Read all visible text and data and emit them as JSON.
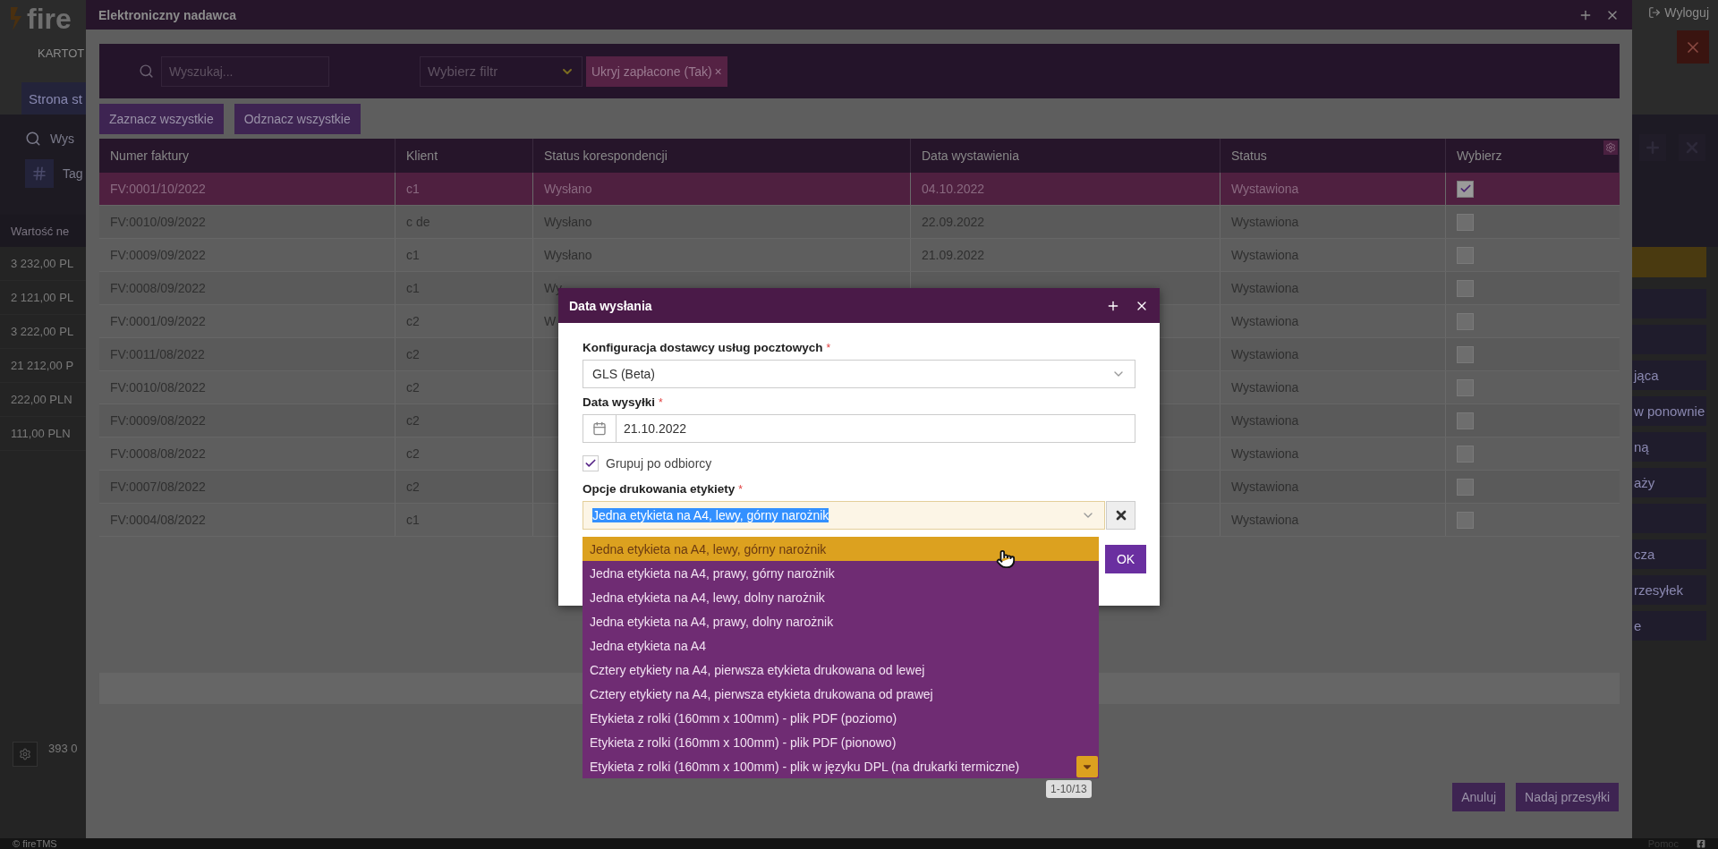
{
  "app_background": {
    "logo": "fire",
    "nav_item": "KARTOT",
    "tab": "Strona st",
    "search_text": "Wys",
    "tag_filter": "Tag",
    "column_header": "Wartość ne",
    "net_values": [
      "3 232,00 PL",
      "2 121,00 PL",
      "3 222,00 PL",
      "21 212,00 P",
      "222,00 PLN",
      "111,00 PLN"
    ],
    "summary": "393 0",
    "logout": "Wyloguj",
    "side_buttons": [
      {
        "kind": "accent"
      },
      {
        "kind": "plain"
      },
      {
        "kind": "plain"
      },
      {
        "kind": "plain",
        "label": "jąca"
      },
      {
        "kind": "plain",
        "label": "w ponownie"
      },
      {
        "kind": "plain",
        "label": "ną"
      },
      {
        "kind": "plain",
        "label": "aży"
      },
      {
        "kind": "plain"
      },
      {
        "kind": "plain",
        "label": "cza"
      },
      {
        "kind": "plain",
        "label": "rzesyłek"
      },
      {
        "kind": "plain",
        "label": "e"
      }
    ]
  },
  "footer": {
    "copyright": "© fireTMS",
    "help": "Pomoc"
  },
  "modal": {
    "title": "Elektroniczny nadawca",
    "search": {
      "placeholder": "Wyszukaj..."
    },
    "filter": {
      "placeholder": "Wybierz filtr"
    },
    "chips": [
      {
        "label": "Ukryj zapłacone (Tak)",
        "remove": "×"
      }
    ],
    "actions": [
      "Zaznacz wszystkie",
      "Odznacz wszystkie"
    ],
    "table": {
      "columns": [
        "Numer faktury",
        "Klient",
        "Status korespondencji",
        "Data wystawienia",
        "Status",
        "Wybierz"
      ],
      "rows": [
        {
          "number": "FV:0001/10/2022",
          "client": "c1",
          "correspondence": "Wysłano",
          "issued": "04.10.2022",
          "status": "Wystawiona",
          "selected": true,
          "checked": true
        },
        {
          "number": "FV:0010/09/2022",
          "client": "c de",
          "correspondence": "Wysłano",
          "issued": "22.09.2022",
          "status": "Wystawiona",
          "selected": false,
          "checked": false
        },
        {
          "number": "FV:0009/09/2022",
          "client": "c1",
          "correspondence": "Wysłano",
          "issued": "21.09.2022",
          "status": "Wystawiona",
          "selected": false,
          "checked": false
        },
        {
          "number": "FV:0008/09/2022",
          "client": "c1",
          "correspondence": "Wy",
          "status": "Wystawiona",
          "selected": false,
          "checked": false
        },
        {
          "number": "FV:0001/09/2022",
          "client": "c2",
          "correspondence": "W",
          "status": "Wystawiona",
          "selected": false,
          "checked": false
        },
        {
          "number": "FV:0011/08/2022",
          "client": "c2",
          "status": "Wystawiona",
          "selected": false,
          "checked": false
        },
        {
          "number": "FV:0010/08/2022",
          "client": "c2",
          "status": "Wystawiona",
          "selected": false,
          "checked": false
        },
        {
          "number": "FV:0009/08/2022",
          "client": "c2",
          "status": "Wystawiona",
          "selected": false,
          "checked": false
        },
        {
          "number": "FV:0008/08/2022",
          "client": "c2",
          "status": "Wystawiona",
          "selected": false,
          "checked": false
        },
        {
          "number": "FV:0007/08/2022",
          "client": "c2",
          "status": "Wystawiona",
          "selected": false,
          "checked": false
        },
        {
          "number": "FV:0004/08/2022",
          "client": "c1",
          "status": "Wystawiona",
          "selected": false,
          "checked": false
        }
      ]
    },
    "buttons": [
      "Anuluj",
      "Nadaj przesyłki"
    ]
  },
  "dialog": {
    "title": "Data wysłania",
    "fields": [
      {
        "kind": "select",
        "label": "Konfiguracja dostawcy usług pocztowych",
        "required_mark": "*",
        "value": "GLS (Beta)"
      },
      {
        "kind": "date",
        "label": "Data wysyłki",
        "required_mark": "*",
        "value": "21.10.2022"
      },
      {
        "kind": "checkbox",
        "label": "Grupuj po odbiorcy",
        "checked": true
      },
      {
        "kind": "select",
        "label": "Opcje drukowania etykiety",
        "required_mark": "*",
        "value": "Jedna etykieta na A4, lewy, górny narożnik",
        "clearable": true,
        "open": true
      }
    ],
    "ok": "OK",
    "dropdown": {
      "options": [
        {
          "label": "Jedna etykieta na A4, lewy, górny narożnik",
          "selected": true
        },
        {
          "label": "Jedna etykieta na A4, prawy, górny narożnik",
          "selected": false
        },
        {
          "label": "Jedna etykieta na A4, lewy, dolny narożnik",
          "selected": false
        },
        {
          "label": "Jedna etykieta na A4, prawy, dolny narożnik",
          "selected": false
        },
        {
          "label": "Jedna etykieta na A4",
          "selected": false
        },
        {
          "label": "Cztery etykiety na A4, pierwsza etykieta drukowana od lewej",
          "selected": false
        },
        {
          "label": "Cztery etykiety na A4, pierwsza etykieta drukowana od prawej",
          "selected": false
        },
        {
          "label": "Etykieta z rolki (160mm x 100mm) - plik PDF (poziomo)",
          "selected": false
        },
        {
          "label": "Etykieta z rolki (160mm x 100mm) - plik PDF (pionowo)",
          "selected": false
        },
        {
          "label": "Etykieta z rolki (160mm x 100mm) - plik w języku DPL (na drukarki termiczne)",
          "selected": false
        }
      ],
      "counter": "1-10/13"
    }
  }
}
